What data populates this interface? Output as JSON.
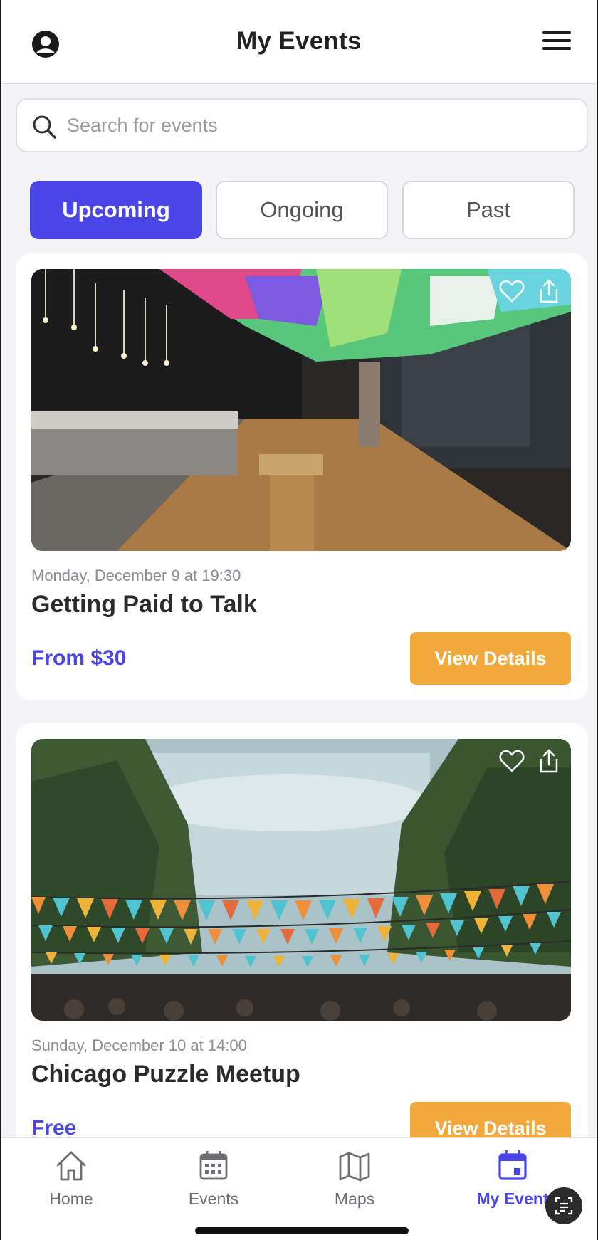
{
  "header": {
    "title": "My Events"
  },
  "search": {
    "placeholder": "Search for events"
  },
  "tabs": [
    {
      "label": "Upcoming",
      "active": true
    },
    {
      "label": "Ongoing",
      "active": false
    },
    {
      "label": "Past",
      "active": false
    }
  ],
  "events": [
    {
      "date": "Monday, December 9 at 19:30",
      "title": "Getting Paid to Talk",
      "price": "From $30",
      "button_label": "View Details",
      "image_icon": "venue-interior-photo"
    },
    {
      "date": "Sunday, December 10 at 14:00",
      "title": "Chicago Puzzle Meetup",
      "price": "Free",
      "button_label": "View Details",
      "image_icon": "outdoor-bunting-photo"
    }
  ],
  "nav": [
    {
      "label": "Home",
      "icon": "home-icon",
      "active": false
    },
    {
      "label": "Events",
      "icon": "calendar-icon",
      "active": false
    },
    {
      "label": "Maps",
      "icon": "map-icon",
      "active": false
    },
    {
      "label": "My Event",
      "icon": "calendar-filled-icon",
      "active": true
    }
  ],
  "colors": {
    "accent": "#4a46e6",
    "button": "#f0a93a",
    "background": "#f4f4f6"
  }
}
